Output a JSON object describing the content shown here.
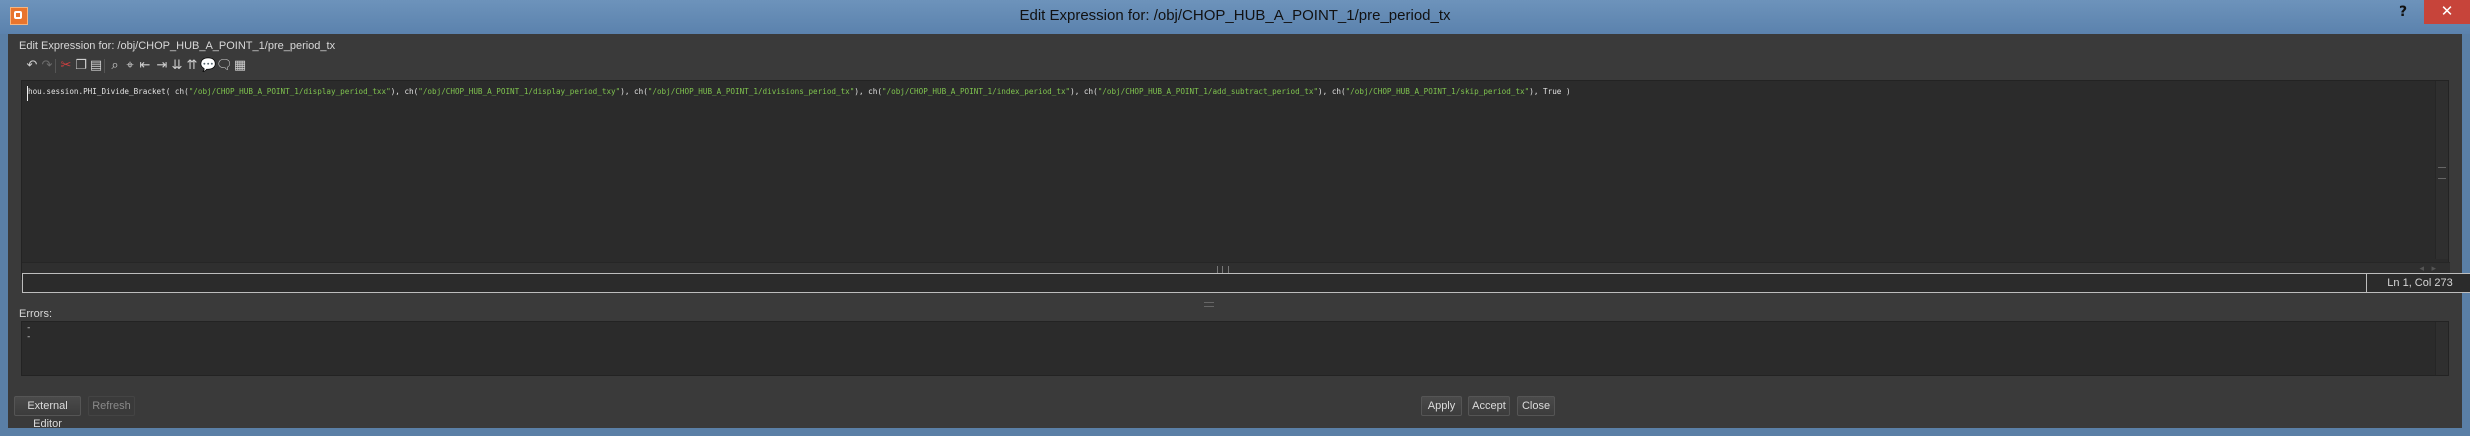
{
  "window": {
    "title": "Edit Expression for: /obj/CHOP_HUB_A_POINT_1/pre_period_tx",
    "help_label": "?",
    "close_label": "✕"
  },
  "dialog": {
    "header": "Edit Expression for: /obj/CHOP_HUB_A_POINT_1/pre_period_tx"
  },
  "toolbar": {
    "icons": [
      "undo-icon",
      "redo-icon",
      "cut-icon",
      "copy-icon",
      "paste-icon",
      "find-icon",
      "find-replace-icon",
      "unindent-icon",
      "indent-icon",
      "comment-icon",
      "uncomment-icon",
      "speech-bubble-icon",
      "speech-bubble-alt-icon",
      "script-icon"
    ]
  },
  "editor": {
    "code": [
      {
        "t": "hou.session.PHI_Divide_Bracket( ch(",
        "c": "plain"
      },
      {
        "t": "\"/obj/CHOP_HUB_A_POINT_1/display_period_txx\"",
        "c": "str"
      },
      {
        "t": "), ch(",
        "c": "plain"
      },
      {
        "t": "\"/obj/CHOP_HUB_A_POINT_1/display_period_txy\"",
        "c": "str"
      },
      {
        "t": "), ch(",
        "c": "plain"
      },
      {
        "t": "\"/obj/CHOP_HUB_A_POINT_1/divisions_period_tx\"",
        "c": "str"
      },
      {
        "t": "), ch(",
        "c": "plain"
      },
      {
        "t": "\"/obj/CHOP_HUB_A_POINT_1/index_period_tx\"",
        "c": "str"
      },
      {
        "t": "), ch(",
        "c": "plain"
      },
      {
        "t": "\"/obj/CHOP_HUB_A_POINT_1/add_subtract_period_tx\"",
        "c": "str"
      },
      {
        "t": "), ch(",
        "c": "plain"
      },
      {
        "t": "\"/obj/CHOP_HUB_A_POINT_1/skip_period_tx\"",
        "c": "str"
      },
      {
        "t": "), True )",
        "c": "plain"
      }
    ],
    "cursor_position": "Ln 1, Col 273"
  },
  "errors": {
    "label": "Errors:",
    "content": "-\n-"
  },
  "buttons": {
    "external_editor": "External Editor",
    "refresh": "Refresh",
    "apply": "Apply",
    "accept": "Accept",
    "close": "Close"
  },
  "colors": {
    "string_literal": "#7fc34f",
    "background": "#3a3a3a",
    "close_button": "#c7443a"
  }
}
